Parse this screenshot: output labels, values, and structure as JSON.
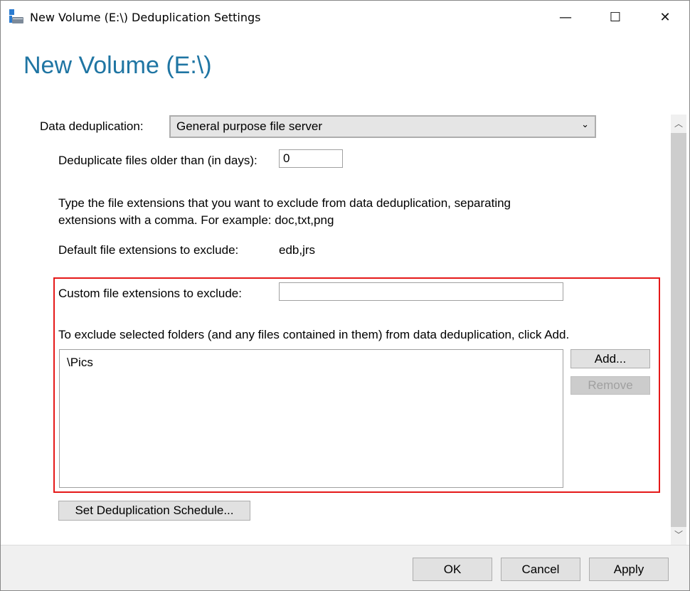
{
  "window": {
    "title": "New Volume (E:\\) Deduplication Settings",
    "minimize": "—",
    "maximize": "☐",
    "close": "✕"
  },
  "heading": "New Volume (E:\\)",
  "dedup": {
    "label": "Data deduplication:",
    "value": "General purpose file server"
  },
  "older": {
    "label": "Deduplicate files older than (in days):",
    "value": "0"
  },
  "instructions": "Type the file extensions that you want to exclude from data deduplication, separating extensions with a comma. For example: doc,txt,png",
  "default_ext": {
    "label": "Default file extensions to exclude:",
    "value": "edb,jrs"
  },
  "custom_ext": {
    "label": "Custom file extensions to exclude:",
    "value": ""
  },
  "folders": {
    "instruction": "To exclude selected folders (and any files contained in them) from data deduplication, click Add.",
    "items": [
      "\\Pics"
    ],
    "add": "Add...",
    "remove": "Remove"
  },
  "schedule_button": "Set Deduplication Schedule...",
  "footer": {
    "ok": "OK",
    "cancel": "Cancel",
    "apply": "Apply"
  }
}
